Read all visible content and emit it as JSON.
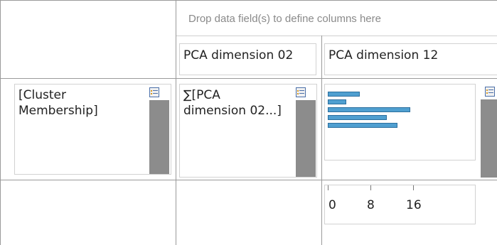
{
  "column_drop_zone": {
    "hint": "Drop data field(s) to define columns here"
  },
  "column_headers": [
    {
      "label": "PCA dimension 02"
    },
    {
      "label": "PCA dimension 12"
    }
  ],
  "row_field": {
    "label": "[Cluster Membership]"
  },
  "data_field": {
    "label": "∑[PCA dimension 02...]"
  },
  "chart_data": {
    "type": "bar",
    "orientation": "horizontal",
    "categories": [
      "",
      "",
      "",
      "",
      ""
    ],
    "values": [
      6,
      3.5,
      15.5,
      11,
      13
    ],
    "xlim": [
      0,
      21
    ],
    "ticks": [
      "0",
      "8",
      "16"
    ],
    "colors": {
      "fill": "#4f9fd0",
      "stroke": "#2c6f9e"
    }
  }
}
